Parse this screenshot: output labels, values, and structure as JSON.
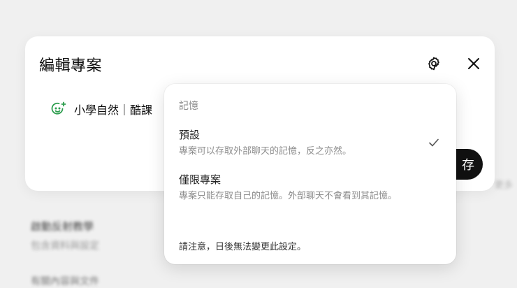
{
  "background": {
    "item_title": "啟動反射教學",
    "item_subtitle": "包含資料與設定",
    "bottom_line": "有關內容與文件",
    "right_text": "更多"
  },
  "dialog": {
    "title": "編輯專案",
    "project_name": "小學自然｜酷課",
    "save_label": "存",
    "icons": {
      "settings": "gear-icon",
      "close": "close-icon",
      "project": "smiley-sparkle-icon"
    }
  },
  "memory_menu": {
    "header": "記憶",
    "options": [
      {
        "title": "預設",
        "description": "專案可以存取外部聊天的記憶，反之亦然。",
        "selected": true
      },
      {
        "title": "僅限專案",
        "description": "專案只能存取自己的記憶。外部聊天不會看到其記憶。",
        "selected": false
      }
    ],
    "note": "請注意，日後無法變更此設定。"
  },
  "colors": {
    "accent_green": "#2e9e4f",
    "button_dark": "#111111"
  }
}
